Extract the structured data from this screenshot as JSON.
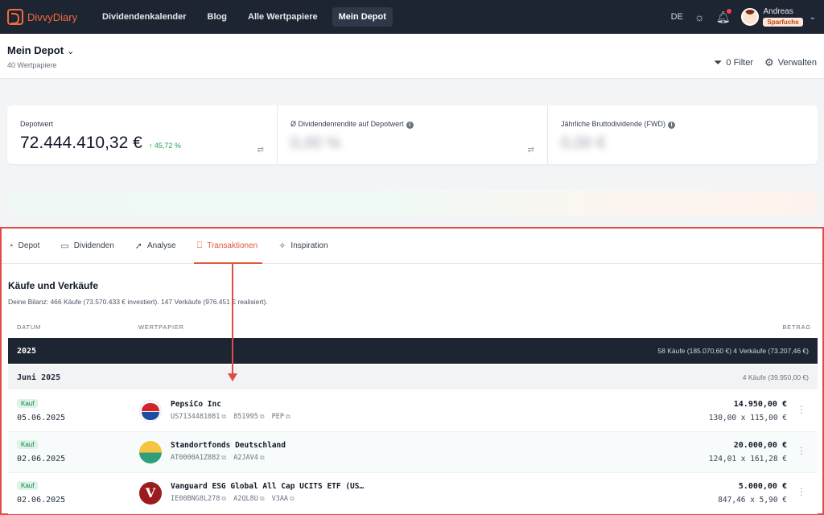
{
  "nav": {
    "logo": "DivvyDiary",
    "links": [
      "Dividendenkalender",
      "Blog",
      "Alle Wertpapiere",
      "Mein Depot"
    ],
    "active_index": 3,
    "language": "DE",
    "user": {
      "name": "Andreas",
      "badge": "Sparfuchs"
    }
  },
  "header": {
    "title": "Mein Depot",
    "subtitle": "40 Wertpapiere",
    "filter_label": "0 Filter",
    "manage_label": "Verwalten"
  },
  "stats": [
    {
      "label": "Depotwert",
      "value": "72.444.410,32 €",
      "change": "↑ 45,72 %"
    },
    {
      "label": "Ø Dividendenrendite auf Depotwert",
      "value": "0,00 %"
    },
    {
      "label": "Jährliche Bruttodividende (FWD)",
      "value": "0,00 €"
    }
  ],
  "tabs": [
    {
      "label": "Depot",
      "icon": "pie-chart-icon"
    },
    {
      "label": "Dividenden",
      "icon": "banknote-icon"
    },
    {
      "label": "Analyse",
      "icon": "rocket-icon"
    },
    {
      "label": "Transaktionen",
      "icon": "book-icon",
      "active": true
    },
    {
      "label": "Inspiration",
      "icon": "sparkles-icon"
    }
  ],
  "transactions": {
    "title": "Käufe und Verkäufe",
    "summary": "Deine Bilanz: 466 Käufe (73.570.433 € investiert). 147 Verkäufe (976.451 € realisiert).",
    "columns": {
      "date": "DATUM",
      "security": "WERTPAPIER",
      "amount": "BETRAG"
    },
    "year": {
      "label": "2025",
      "summary": "58 Käufe (185.070,60 €)   4 Verkäufe (73.207,46 €)"
    },
    "month": {
      "label": "Juni 2025",
      "summary": "4 Käufe (39.950,00 €)"
    },
    "rows": [
      {
        "type": "Kauf",
        "date": "05.06.2025",
        "name": "PepsiCo Inc",
        "isin": "US7134481081",
        "wkn": "851995",
        "ticker": "PEP",
        "amount": "14.950,00 €",
        "detail": "130,00 x 115,00 €",
        "logo": "pepsi"
      },
      {
        "type": "Kauf",
        "date": "02.06.2025",
        "name": "Standortfonds Deutschland",
        "isin": "AT0000A1Z882",
        "wkn": "A2JAV4",
        "ticker": "",
        "amount": "20.000,00 €",
        "detail": "124,01 x 161,28 €",
        "logo": "standort"
      },
      {
        "type": "Kauf",
        "date": "02.06.2025",
        "name": "Vanguard ESG Global All Cap UCITS ETF (US…",
        "isin": "IE00BNG8L278",
        "wkn": "A2QL8U",
        "ticker": "V3AA",
        "amount": "5.000,00 €",
        "detail": "847,46 x 5,90 €",
        "logo": "vanguard"
      }
    ]
  }
}
